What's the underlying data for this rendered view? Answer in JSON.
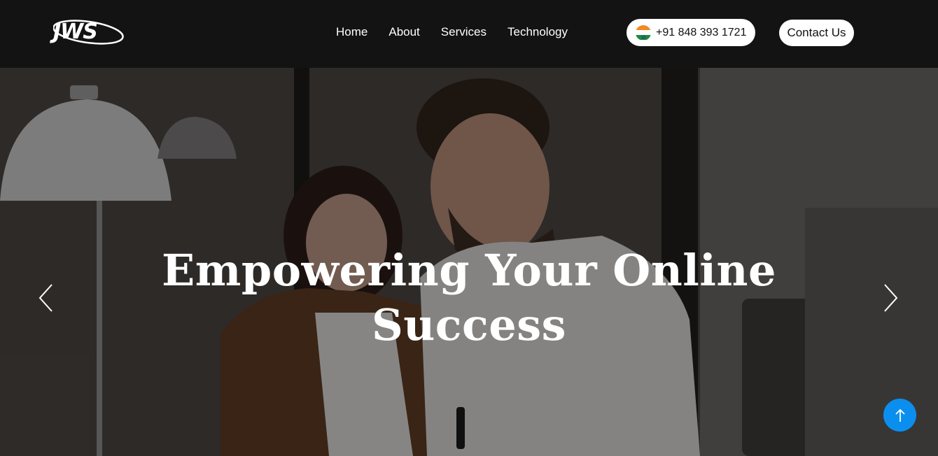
{
  "brand": {
    "logo_text": "JWS"
  },
  "nav": {
    "items": [
      {
        "label": "Home"
      },
      {
        "label": "About"
      },
      {
        "label": "Services"
      },
      {
        "label": "Technology"
      }
    ]
  },
  "phone": {
    "number": "+91 848 393 1721",
    "flag_icon": "india-flag-icon"
  },
  "contact": {
    "label": "Contact Us"
  },
  "hero": {
    "title_line1": "Empowering Your Online",
    "title_line2": "Success"
  },
  "icons": {
    "prev": "chevron-left-icon",
    "next": "chevron-right-icon",
    "scroll_top": "arrow-up-icon"
  },
  "colors": {
    "header_bg": "#131313",
    "accent_blue": "#0b8fef",
    "text_white": "#ffffff"
  }
}
